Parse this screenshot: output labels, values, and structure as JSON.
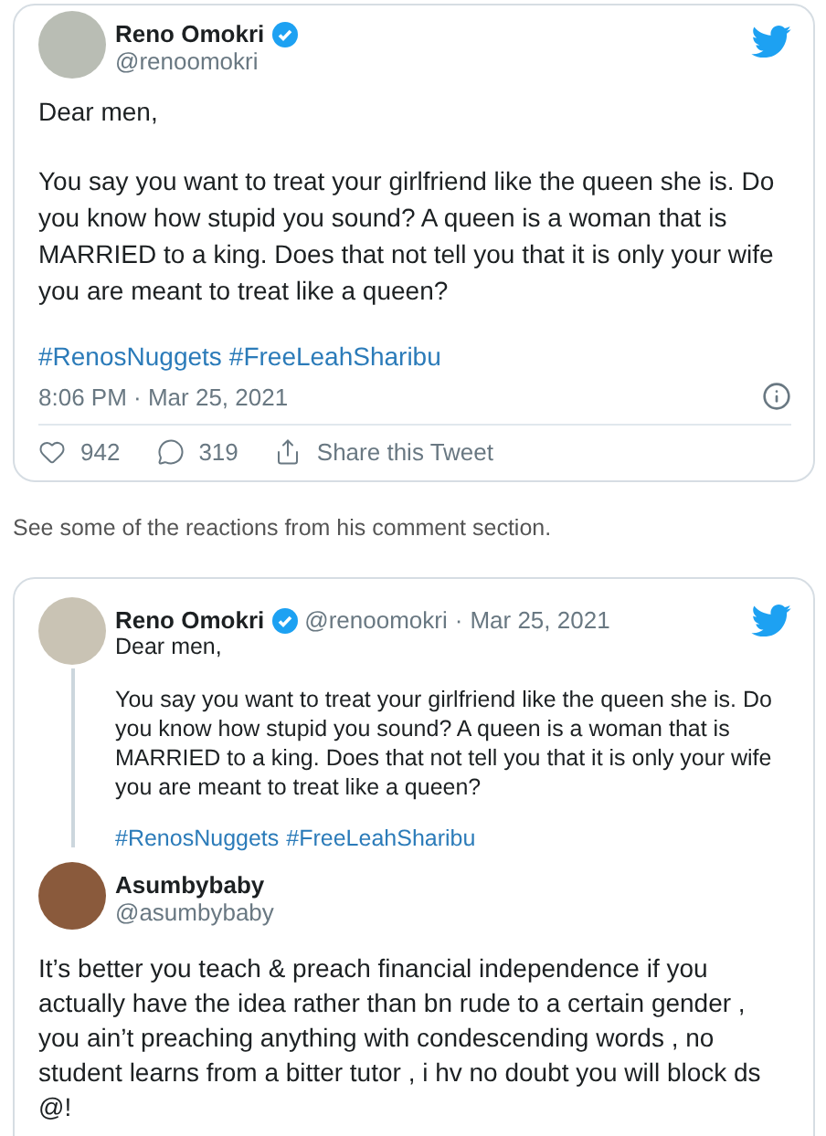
{
  "embedded_tweet": {
    "author": {
      "name": "Reno Omokri",
      "handle": "@renoomokri",
      "verified": true
    },
    "paragraphs": [
      "Dear men,",
      "You say you want to treat your girlfriend like the queen she is. Do you know how stupid you sound? A queen is a woman that is MARRIED to a king. Does that not tell you that it is only your wife you are meant to treat like a queen?"
    ],
    "hashtags": [
      "#RenosNuggets",
      "#FreeLeahSharibu"
    ],
    "timestamp": "8:06 PM · Mar 25, 2021",
    "actions": [
      {
        "kind": "like",
        "label": "942"
      },
      {
        "kind": "reply",
        "label": "319"
      },
      {
        "kind": "share",
        "label": "Share this Tweet"
      }
    ]
  },
  "caption": "See some of the reactions from his comment section.",
  "reply_card": {
    "parent": {
      "author": {
        "name": "Reno Omokri",
        "handle": "@renoomokri",
        "verified": true
      },
      "separator": "·",
      "date": "Mar 25, 2021",
      "paragraphs": [
        "Dear men,",
        "You say you want to treat your girlfriend like the queen she is. Do you know how stupid you sound? A queen is a woman that is MARRIED to a king. Does that not tell you that it is only your wife you are meant to treat like a queen?"
      ],
      "hashtags": [
        "#RenosNuggets",
        "#FreeLeahSharibu"
      ]
    },
    "reply": {
      "author": {
        "name": "Asumbybaby",
        "handle": "@asumbybaby"
      },
      "text": "It’s better you teach & preach financial independence if you actually have the idea rather than bn rude to a certain gender , you ain’t preaching anything with condescending words , no student learns from a bitter tutor , i hv no doubt you will block ds @!"
    }
  }
}
